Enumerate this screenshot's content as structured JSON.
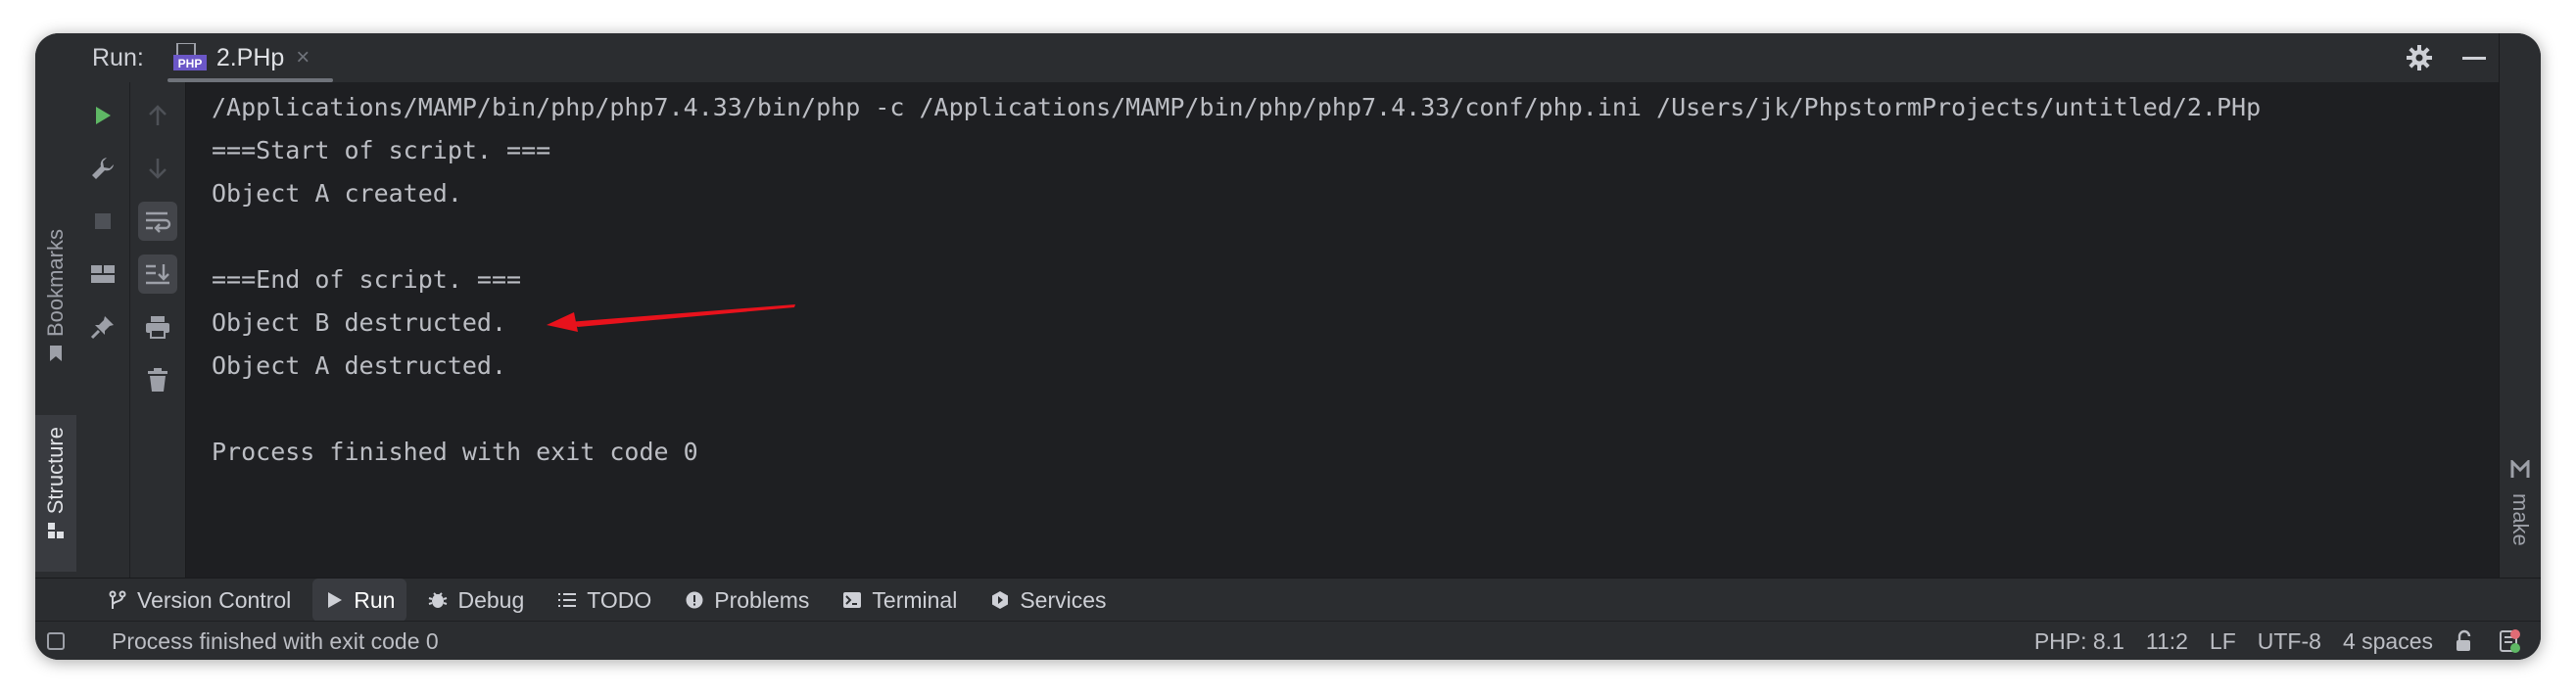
{
  "header": {
    "run_label": "Run:",
    "tab_label": "2.PHp",
    "tab_close": "×",
    "tab_icon_text": "PHP"
  },
  "left_strip": {
    "bookmarks_label": "Bookmarks",
    "structure_label": "Structure"
  },
  "right_strip": {
    "make_label": "make"
  },
  "console": {
    "lines": [
      "/Applications/MAMP/bin/php/php7.4.33/bin/php -c /Applications/MAMP/bin/php/php7.4.33/conf/php.ini /Users/jk/PhpstormProjects/untitled/2.PHp",
      "===Start of script. ===",
      "Object A created.",
      "",
      "===End of script. ===",
      "Object B destructed.",
      "Object A destructed.",
      "",
      "Process finished with exit code 0"
    ]
  },
  "tool_windows": [
    {
      "label": "Version Control",
      "icon": "branch-icon"
    },
    {
      "label": "Run",
      "icon": "play-icon"
    },
    {
      "label": "Debug",
      "icon": "bug-icon"
    },
    {
      "label": "TODO",
      "icon": "list-icon"
    },
    {
      "label": "Problems",
      "icon": "info-icon"
    },
    {
      "label": "Terminal",
      "icon": "terminal-icon"
    },
    {
      "label": "Services",
      "icon": "services-icon"
    }
  ],
  "status_bar": {
    "message": "Process finished with exit code 0",
    "php_version": "PHP: 8.1",
    "position": "11:2",
    "line_separator": "LF",
    "encoding": "UTF-8",
    "indent": "4 spaces"
  },
  "colors": {
    "run_green": "#5fb865",
    "annotation_red": "#e8121c",
    "background": "#1e1f22",
    "panel": "#2b2d30"
  }
}
